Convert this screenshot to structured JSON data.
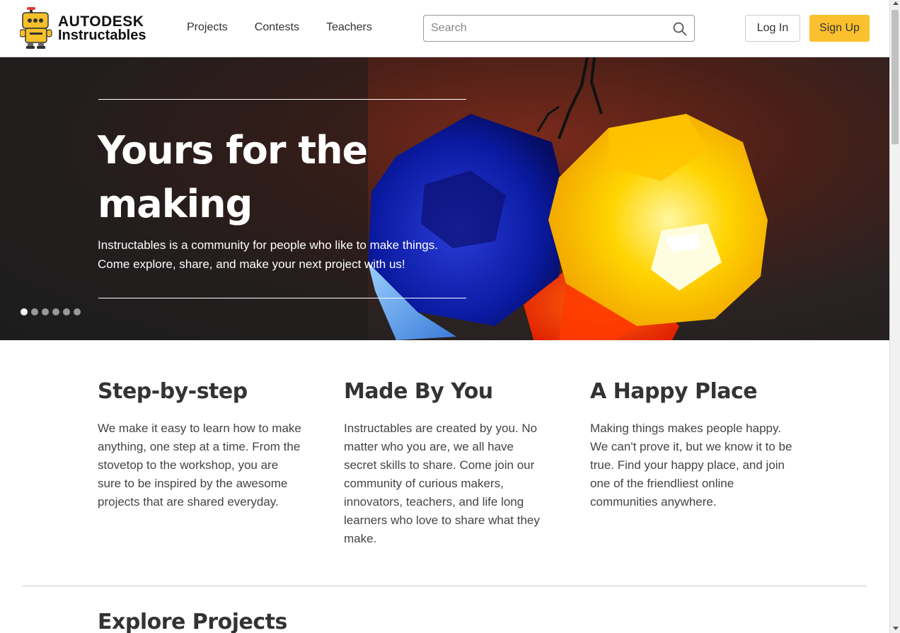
{
  "header": {
    "logo_brand": "AUTODESK",
    "logo_product": "Instructables",
    "nav": [
      {
        "label": "Projects"
      },
      {
        "label": "Contests"
      },
      {
        "label": "Teachers"
      }
    ],
    "search_placeholder": "Search",
    "login_label": "Log In",
    "signup_label": "Sign Up"
  },
  "hero": {
    "title": "Yours for the making",
    "subtitle": "Instructables is a community for people who like to make things. Come explore, share, and make your next project with us!",
    "slide_count": 6,
    "active_slide": 1
  },
  "features": [
    {
      "title": "Step-by-step",
      "text": "We make it easy to learn how to make anything, one step at a time. From the stovetop to the workshop, you are sure to be inspired by the awesome projects that are shared everyday."
    },
    {
      "title": "Made By You",
      "text": "Instructables are created by you. No matter who you are, we all have secret skills to share. Come join our community of curious makers, innovators, teachers, and life long learners who love to share what they make."
    },
    {
      "title": "A Happy Place",
      "text": "Making things makes people happy. We can't prove it, but we know it to be true. Find your happy place, and join one of the friendliest online communities anywhere."
    }
  ],
  "explore_title": "Explore Projects",
  "colors": {
    "signup_bg": "#fbc02d",
    "robot_yellow": "#f5c02a"
  }
}
